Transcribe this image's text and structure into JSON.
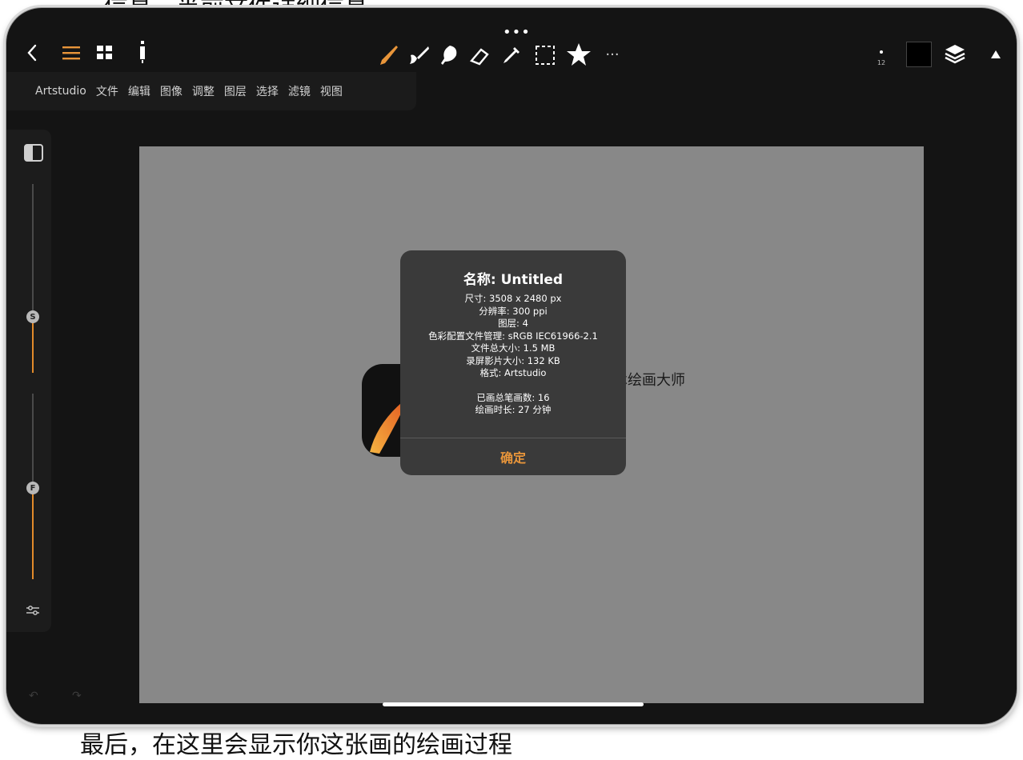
{
  "captions": {
    "top": "…信息。当前文件详细信息",
    "bottom": "最后，在这里会显示你这张画的绘画过程"
  },
  "toolbar": {
    "left_icons": [
      "back-icon",
      "menu-icon",
      "grid-icon",
      "info-icon"
    ],
    "tools": [
      "brush-icon",
      "smudge-icon",
      "blur-icon",
      "eraser-icon",
      "eyedropper-icon",
      "selection-icon",
      "favorite-icon",
      "more-icon"
    ],
    "brush_size": "12",
    "color_swatch": "#000000",
    "accent": "#e8953a"
  },
  "menu": {
    "items": [
      "Artstudio",
      "文件",
      "编辑",
      "图像",
      "调整",
      "图层",
      "选择",
      "滤镜",
      "视图"
    ]
  },
  "left_panel": {
    "size_knob": "S",
    "flow_knob": "F",
    "size_level": 0.45,
    "flow_level": 0.45
  },
  "canvas": {
    "title_text": "术绘画大师"
  },
  "dialog": {
    "title": "名称: Untitled",
    "lines": [
      "尺寸: 3508 x 2480 px",
      "分辨率: 300 ppi",
      "图层: 4",
      "色彩配置文件管理: sRGB IEC61966-2.1",
      "文件总大小: 1.5 MB",
      "录屏影片大小: 132 KB",
      "格式: Artstudio"
    ],
    "extra_lines": [
      "已画总笔画数: 16",
      "绘画时长: 27 分钟"
    ],
    "confirm": "确定"
  }
}
